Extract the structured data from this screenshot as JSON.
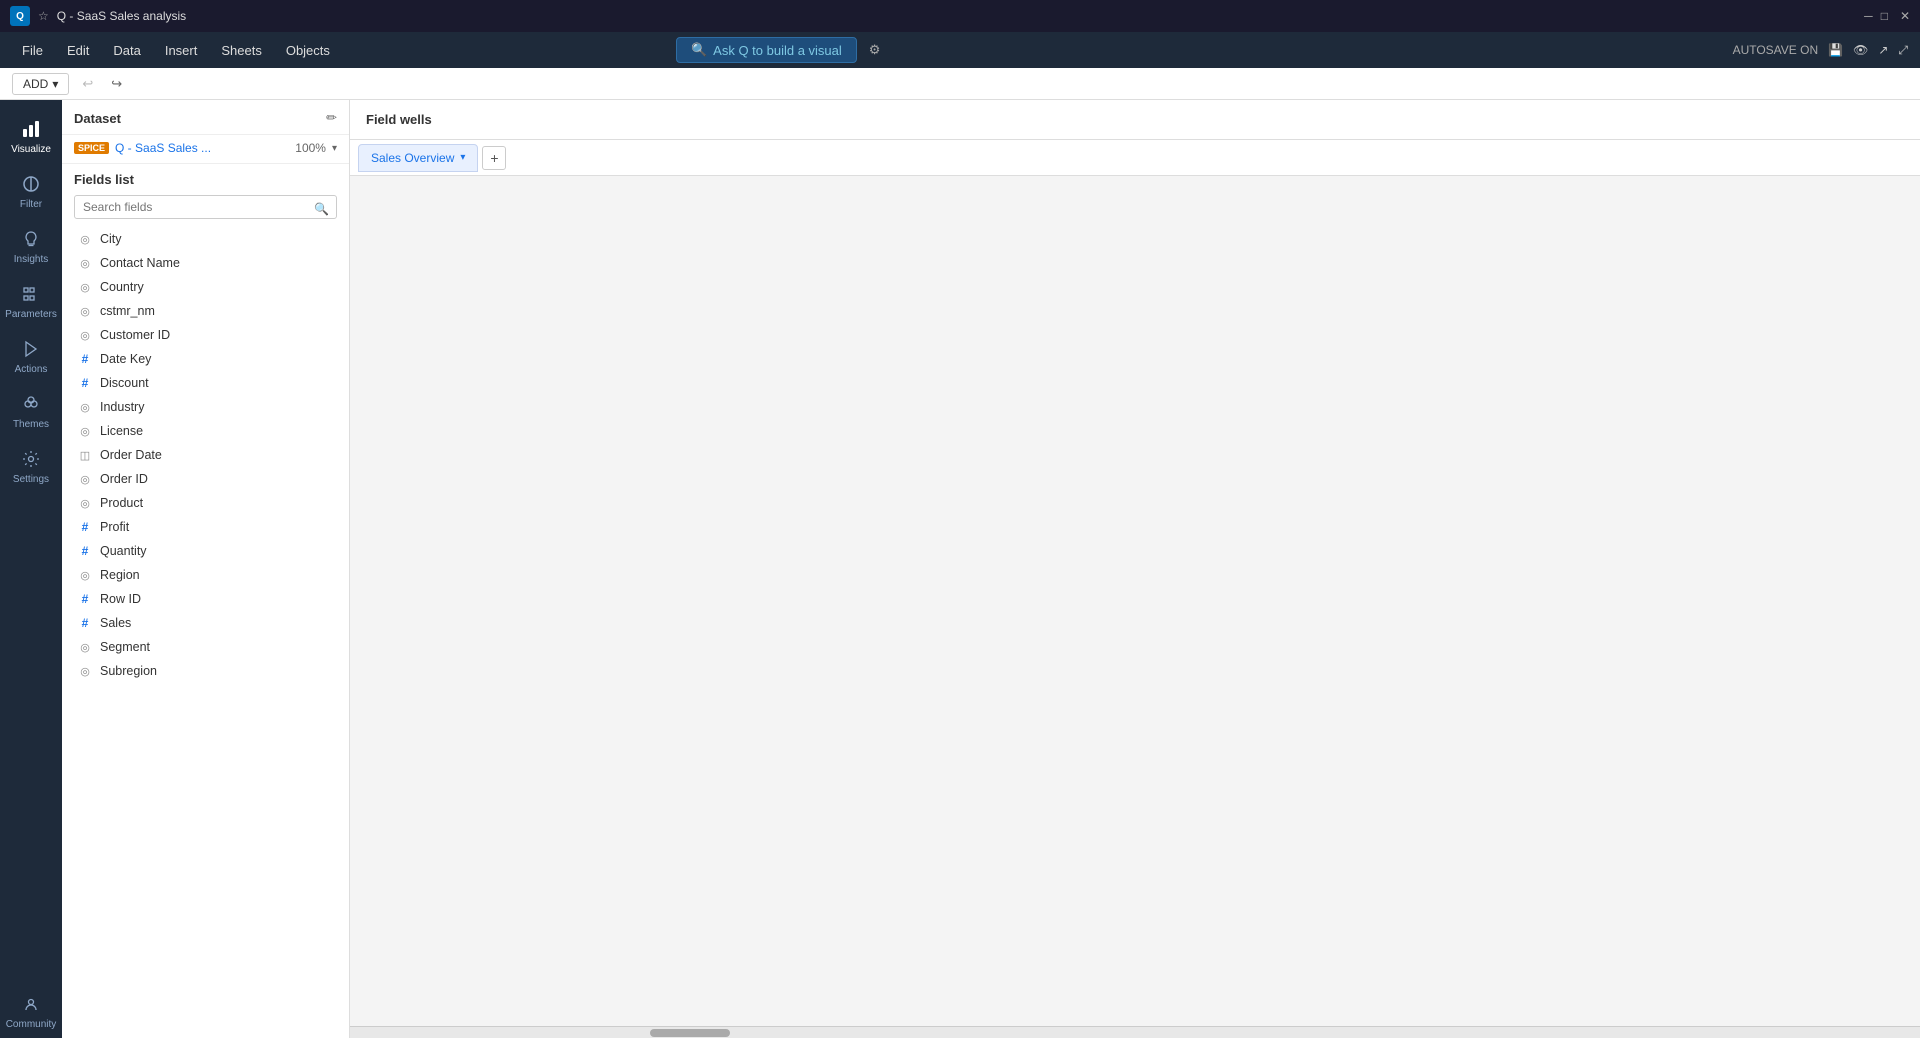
{
  "titlebar": {
    "logo": "Q",
    "star": "☆",
    "title": "Q - SaaS Sales analysis",
    "window_controls": [
      "─",
      "□",
      "✕"
    ]
  },
  "menubar": {
    "items": [
      "File",
      "Edit",
      "Data",
      "Insert",
      "Sheets",
      "Objects"
    ],
    "ask_q_label": "Ask Q to build a visual",
    "autosave_label": "AUTOSAVE ON"
  },
  "toolbar": {
    "add_label": "ADD",
    "add_chevron": "▾",
    "undo_icon": "↩",
    "redo_icon": "↪"
  },
  "sidebar": {
    "items": [
      {
        "id": "visualize",
        "label": "Visualize",
        "icon": "📊",
        "active": true
      },
      {
        "id": "filter",
        "label": "Filter",
        "icon": "⊘"
      },
      {
        "id": "insights",
        "label": "Insights",
        "icon": "💡"
      },
      {
        "id": "parameters",
        "label": "Parameters",
        "icon": "⊞"
      },
      {
        "id": "actions",
        "label": "Actions",
        "icon": "⚡"
      },
      {
        "id": "themes",
        "label": "Themes",
        "icon": "🎨"
      },
      {
        "id": "settings",
        "label": "Settings",
        "icon": "⚙"
      }
    ],
    "bottom_items": [
      {
        "id": "community",
        "label": "Community",
        "icon": "👥"
      }
    ]
  },
  "fields_panel": {
    "dataset_title": "Dataset",
    "spice_label": "SPICE",
    "dataset_name": "Q - SaaS Sales ...",
    "dataset_percent": "100%",
    "fields_list_title": "Fields list",
    "search_placeholder": "Search fields",
    "fields": [
      {
        "name": "City",
        "type": "geo"
      },
      {
        "name": "Contact Name",
        "type": "string"
      },
      {
        "name": "Country",
        "type": "geo"
      },
      {
        "name": "cstmr_nm",
        "type": "string"
      },
      {
        "name": "Customer ID",
        "type": "string"
      },
      {
        "name": "Date Key",
        "type": "numeric"
      },
      {
        "name": "Discount",
        "type": "numeric"
      },
      {
        "name": "Industry",
        "type": "string"
      },
      {
        "name": "License",
        "type": "string"
      },
      {
        "name": "Order Date",
        "type": "date"
      },
      {
        "name": "Order ID",
        "type": "string"
      },
      {
        "name": "Product",
        "type": "string"
      },
      {
        "name": "Profit",
        "type": "numeric"
      },
      {
        "name": "Quantity",
        "type": "numeric"
      },
      {
        "name": "Region",
        "type": "geo"
      },
      {
        "name": "Row ID",
        "type": "numeric"
      },
      {
        "name": "Sales",
        "type": "numeric"
      },
      {
        "name": "Segment",
        "type": "string"
      },
      {
        "name": "Subregion",
        "type": "geo"
      }
    ]
  },
  "main": {
    "field_wells_title": "Field wells",
    "sheet_tab_label": "Sales Overview",
    "add_sheet_icon": "+"
  }
}
